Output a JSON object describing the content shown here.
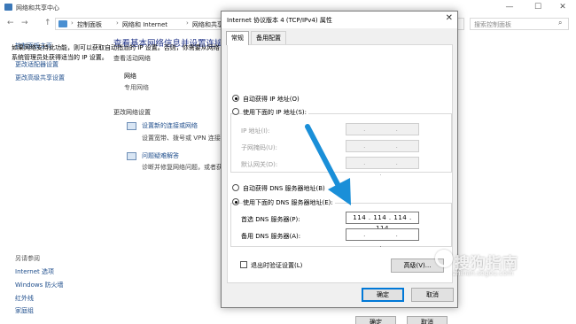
{
  "background_window": {
    "title": "网络和共享中心",
    "window_controls": {
      "minimize": "—",
      "maximize": "☐",
      "close": "✕"
    },
    "nav": {
      "back": "←",
      "forward": "→",
      "up": "↑"
    },
    "breadcrumb": [
      "控制面板",
      "网络和 Internet",
      "网络和共享中心"
    ],
    "breadcrumb_sep": "›",
    "search_placeholder": "搜索控制面板",
    "search_icon": "search-icon",
    "sidebar": {
      "links": [
        "控制面板主页",
        "更改适配器设置",
        "更改高级共享设置"
      ],
      "see_also_heading": "另请参阅",
      "see_also": [
        "Internet 选项",
        "Windows 防火墙",
        "红外线",
        "家庭组"
      ]
    },
    "main": {
      "heading": "查看基本网络信息并设置连接",
      "active_networks_label": "查看活动网络",
      "network_name": "网络",
      "network_type": "专用网络",
      "change_settings_label": "更改网络设置",
      "task1_link": "设置新的连接或网络",
      "task1_desc": "设置宽带、拨号或 VPN 连接；或设置",
      "task2_link": "问题疑难解答",
      "task2_desc": "诊断并修复网络问题，或者获"
    },
    "under_buttons": {
      "ok": "确定",
      "cancel": "取消"
    }
  },
  "dialog": {
    "title": "Internet 协议版本 4 (TCP/IPv4) 属性",
    "close_glyph": "✕",
    "tabs": [
      {
        "label": "常规",
        "active": true
      },
      {
        "label": "备用配置",
        "active": false
      }
    ],
    "intro_text": "如果网络支持此功能，则可以获取自动指派的 IP 设置。否则，你需要从网络系统管理员处获得适当的 IP 设置。",
    "ip_auto_label": "自动获得 IP 地址(O)",
    "ip_auto_checked": true,
    "ip_manual_label": "使用下面的 IP 地址(S):",
    "ip_manual_checked": false,
    "ip_fields": [
      {
        "label": "IP 地址(I):",
        "value": ".   .   ."
      },
      {
        "label": "子网掩码(U):",
        "value": ".   .   ."
      },
      {
        "label": "默认网关(D):",
        "value": ".   .   ."
      }
    ],
    "dns_auto_label": "自动获得 DNS 服务器地址(B)",
    "dns_auto_checked": false,
    "dns_manual_label": "使用下面的 DNS 服务器地址(E):",
    "dns_manual_checked": true,
    "dns_fields": [
      {
        "label": "首选 DNS 服务器(P):",
        "value": "114 . 114 . 114 . 114"
      },
      {
        "label": "备用 DNS 服务器(A):",
        "value": ".   .   ."
      }
    ],
    "validate_label": "退出时验证设置(L)",
    "validate_checked": false,
    "advanced_button": "高级(V)...",
    "ok_button": "确定",
    "cancel_button": "取消"
  },
  "colors": {
    "link": "#1f4e8c",
    "heading": "#1e3287",
    "arrow": "#1a8fd8",
    "default_button_border": "#0078d7"
  }
}
